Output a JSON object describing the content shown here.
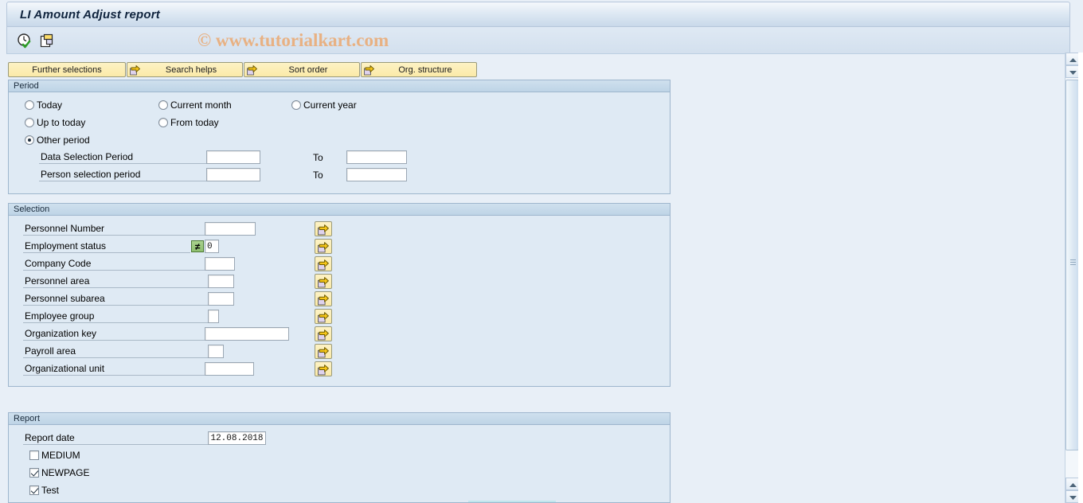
{
  "window": {
    "title": "LI Amount Adjust report",
    "watermark": "© www.tutorialkart.com"
  },
  "toolbar": {
    "icons": [
      {
        "name": "execute-clock-check-icon",
        "tooltip": "Execute"
      },
      {
        "name": "multiple-selection-icon",
        "tooltip": "Multiple selection"
      }
    ]
  },
  "button_row": [
    {
      "label": "Further selections",
      "icon": null
    },
    {
      "label": "Search helps",
      "icon": "arrow-right-icon"
    },
    {
      "label": "Sort order",
      "icon": "arrow-right-icon"
    },
    {
      "label": "Org. structure",
      "icon": "arrow-right-icon"
    }
  ],
  "period": {
    "legend": "Period",
    "radios": [
      {
        "label": "Today",
        "selected": false
      },
      {
        "label": "Current month",
        "selected": false
      },
      {
        "label": "Current year",
        "selected": false
      },
      {
        "label": "Up to today",
        "selected": false
      },
      {
        "label": "From today",
        "selected": false
      },
      {
        "label": "Other period",
        "selected": true
      }
    ],
    "rows": [
      {
        "label": "Data Selection Period",
        "from_value": "",
        "to_label": "To",
        "to_value": ""
      },
      {
        "label": "Person selection period",
        "from_value": "",
        "to_label": "To",
        "to_value": ""
      }
    ]
  },
  "selection": {
    "legend": "Selection",
    "rows": [
      {
        "label": "Personnel Number",
        "value": "",
        "operator": null,
        "multi_icon": "arrow-right-icon"
      },
      {
        "label": "Employment status",
        "value": "0",
        "operator": "≠",
        "multi_icon": "arrow-right-icon"
      },
      {
        "label": "Company Code",
        "value": "",
        "operator": null,
        "multi_icon": "arrow-right-icon"
      },
      {
        "label": "Personnel area",
        "value": "",
        "operator": null,
        "multi_icon": "arrow-right-icon"
      },
      {
        "label": "Personnel subarea",
        "value": "",
        "operator": null,
        "multi_icon": "arrow-right-icon"
      },
      {
        "label": "Employee group",
        "value": "",
        "operator": null,
        "multi_icon": "arrow-right-icon"
      },
      {
        "label": "Organization key",
        "value": "",
        "operator": null,
        "multi_icon": "arrow-right-icon"
      },
      {
        "label": "Payroll area",
        "value": "",
        "operator": null,
        "multi_icon": "arrow-right-icon"
      },
      {
        "label": "Organizational unit",
        "value": "",
        "operator": null,
        "multi_icon": "arrow-right-icon"
      }
    ]
  },
  "report": {
    "legend": "Report",
    "date_label": "Report date",
    "date_value": "12.08.2018",
    "checkboxes": [
      {
        "label": "MEDIUM",
        "checked": false
      },
      {
        "label": "NEWPAGE",
        "checked": true
      },
      {
        "label": "Test",
        "checked": true
      }
    ]
  },
  "colors": {
    "title_text": "#10243e",
    "watermark": "#e8b183",
    "button_face": "#fbeaa8",
    "group_bg": "#dfeaf4",
    "group_header": "#c6dae9",
    "operator_green": "#8fc06f",
    "canvas": "#e8eff7"
  }
}
